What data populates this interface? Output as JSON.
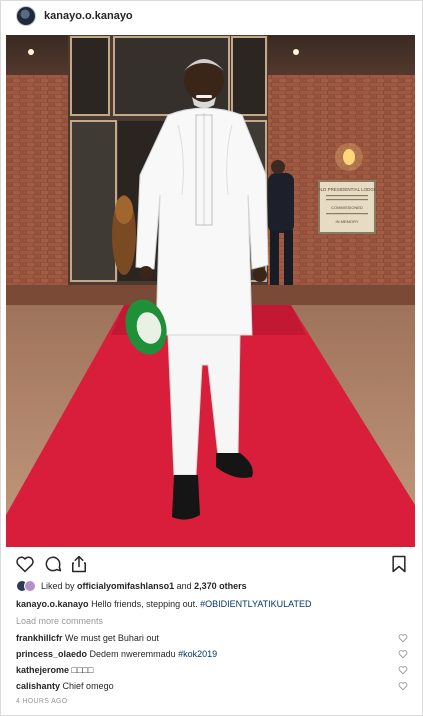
{
  "post": {
    "username": "kanayo.o.kanayo"
  },
  "likes": {
    "prefix": "Liked by",
    "first_user": "officialyomifashlanso1",
    "joiner": "and",
    "others": "2,370 others"
  },
  "caption": {
    "username": "kanayo.o.kanayo",
    "text": "Hello friends, stepping out.",
    "hashtag": "#OBIDIENTLYATIKULATED"
  },
  "load_more": "Load more comments",
  "comments": [
    {
      "username": "frankhillcfr",
      "text": "We must get Buhari out",
      "hashtag": ""
    },
    {
      "username": "princess_olaedo",
      "text": "Dedem nweremmadu",
      "hashtag": "#kok2019"
    },
    {
      "username": "kathejerome",
      "text": "□□□□",
      "hashtag": ""
    },
    {
      "username": "calishanty",
      "text": "Chief omego",
      "hashtag": ""
    }
  ],
  "timestamp": "4 HOURS AGO",
  "sign": {
    "line1": "OLD PRESIDENTIAL LODGE",
    "line2": "COMMISSIONED",
    "line3": "IN MEMORY"
  },
  "icons": {
    "like": "heart-icon",
    "comment": "comment-icon",
    "share": "share-icon",
    "save": "bookmark-icon"
  },
  "colors": {
    "carpet": "#d81e3a",
    "hashtag": "#003569",
    "muted": "#999999",
    "border": "#dbdbdb"
  }
}
